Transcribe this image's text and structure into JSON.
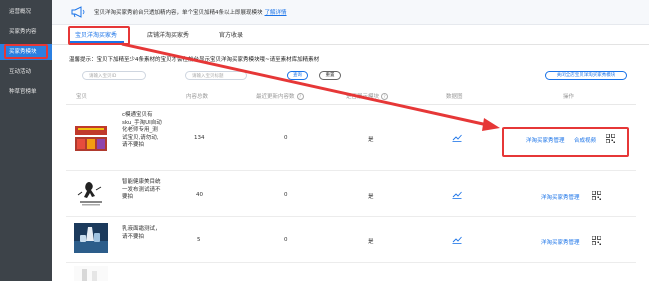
{
  "sidebar": {
    "items": [
      {
        "label": "运营概况",
        "active": false
      },
      {
        "label": "买家秀内容",
        "active": false
      },
      {
        "label": "买家秀模块",
        "active": true
      },
      {
        "label": "互动活动",
        "active": false
      },
      {
        "label": "种草官榜单",
        "active": false
      }
    ]
  },
  "notice": {
    "text": "宝贝洋淘买家秀前台只透加精内容，单个宝贝加精4条以上即展现模块",
    "link": "了解详情"
  },
  "tabs": [
    {
      "label": "宝贝洋淘买家秀",
      "active": true
    },
    {
      "label": "店铺洋淘买家秀",
      "active": false
    },
    {
      "label": "官方收录",
      "active": false
    }
  ],
  "tip": "温馨提示：宝贝下加精至少4条素材的宝贝才会在前台显示宝贝洋淘买家秀模块哦~请至素材库加精素材",
  "filters": {
    "item_placeholder": "请输入宝贝ID",
    "name_placeholder": "请输入宝贝标题",
    "query_label": "查询",
    "reset_label": "重置",
    "close_all_label": "关闭全店宝贝洋淘买家秀模块"
  },
  "table": {
    "headers": {
      "item": "宝贝",
      "total": "内容总数",
      "recent": "最近更新内容数",
      "module": "是否展示模块",
      "chart": "数据图",
      "ops": "操作"
    },
    "rows": [
      {
        "name": "c模通宝贝有sku_手淘UI自动化老师专用_测试宝贝,请勿动,请不要拍",
        "total": "134",
        "recent": "0",
        "shown": "是",
        "op1": "洋淘买家秀管理",
        "op2": "合成视频"
      },
      {
        "name": "智能健康美目统一发布测试请不要拍",
        "total": "40",
        "recent": "0",
        "shown": "是",
        "op1": "洋淘买家秀管理",
        "op2": ""
      },
      {
        "name": "乳液面霜测试，请不要拍",
        "total": "5",
        "recent": "0",
        "shown": "是",
        "op1": "洋淘买家秀管理",
        "op2": ""
      }
    ]
  },
  "colors": {
    "accent": "#1a73e8",
    "highlight_red": "#e63737",
    "sidebar_bg": "#3d4349"
  }
}
